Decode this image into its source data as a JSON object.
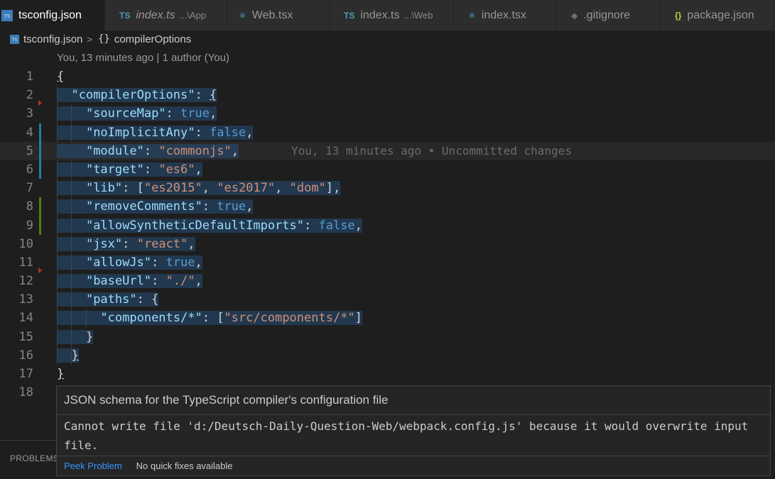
{
  "tabs": [
    {
      "icon": "TS",
      "label": "tsconfig.json",
      "desc": "",
      "active": true
    },
    {
      "icon": "TS",
      "label": "index.ts",
      "desc": "...\\App",
      "italic": true
    },
    {
      "icon": "react",
      "label": "Web.tsx",
      "desc": ""
    },
    {
      "icon": "TS",
      "label": "index.ts",
      "desc": "...\\Web"
    },
    {
      "icon": "react",
      "label": "index.tsx",
      "desc": ""
    },
    {
      "icon": "git",
      "label": ".gitignore",
      "desc": ""
    },
    {
      "icon": "{}",
      "label": "package.json",
      "desc": ""
    }
  ],
  "breadcrumb": {
    "file": "tsconfig.json",
    "separator": ">",
    "symbol_icon": "{}",
    "symbol": "compilerOptions"
  },
  "codelens": "You, 13 minutes ago | 1 author (You)",
  "editor": {
    "line_numbers": [
      "1",
      "2",
      "3",
      "4",
      "5",
      "6",
      "7",
      "8",
      "9",
      "10",
      "11",
      "12",
      "13",
      "14",
      "15",
      "16",
      "17",
      "18"
    ],
    "blame_line": "You, 13 minutes ago • Uncommitted changes",
    "colors": {
      "key": "#9cdcfe",
      "string": "#ce9178",
      "boolean": "#569cd6",
      "modified_gutter": "#1b81a8",
      "added_gutter": "#587c0c",
      "error_marker": "#b3312e"
    }
  },
  "hover": {
    "title": "JSON schema for the TypeScript compiler's configuration file",
    "message": "Cannot write file 'd:/Deutsch-Daily-Question-Web/webpack.config.js' because it would overwrite input file.",
    "peek_label": "Peek Problem",
    "no_fixes_label": "No quick fixes available"
  },
  "panel": {
    "problems_label": "PROBLEMS"
  }
}
